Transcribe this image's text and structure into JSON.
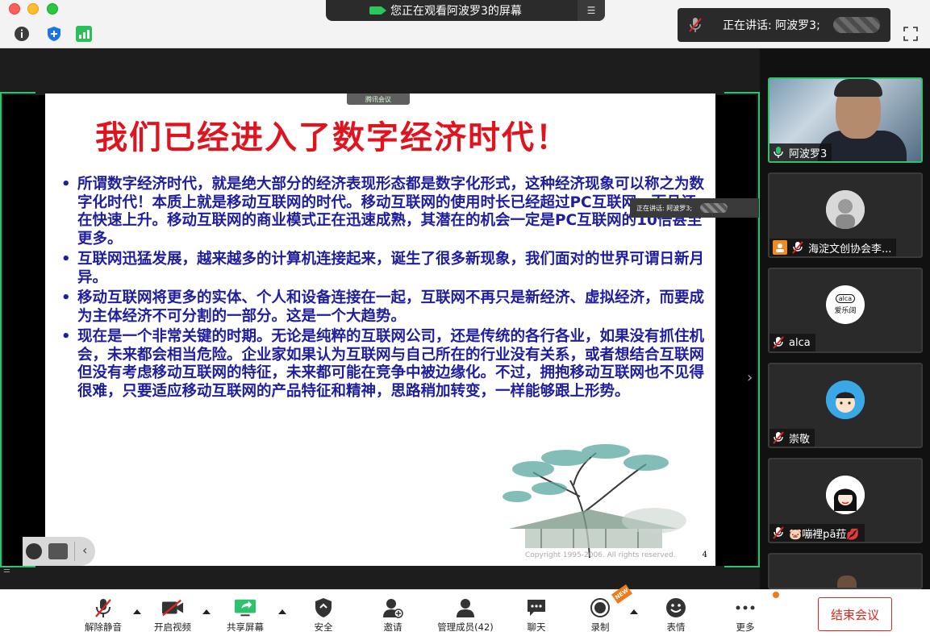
{
  "banner": {
    "text": "您正在观看阿波罗3的屏幕",
    "menu_icon": "menu-icon"
  },
  "speaking": {
    "label": "正在讲话: 阿波罗3;"
  },
  "slide": {
    "tag": "腾讯会议",
    "title": "我们已经进入了数字经济时代！",
    "bullets": [
      "所谓数字经济时代，就是绝大部分的经济表现形态都是数字化形式，这种经济现象可以称之为数字化时代！本质上就是移动互联网的时代。移动互联网的使用时长已经超过PC互联网，而且还在快速上升。移动互联网的商业模式正在迅速成熟，其潜在的机会一定是PC互联网的10倍甚至更多。",
      "互联网迅猛发展，越来越多的计算机连接起来，诞生了很多新现象，我们面对的世界可谓日新月异。",
      "移动互联网将更多的实体、个人和设备连接在一起，互联网不再只是新经济、虚拟经济，而要成为主体经济不可分割的一部分。这是一个大趋势。",
      "现在是一个非常关键的时期。无论是纯粹的互联网公司，还是传统的各行各业，如果没有抓住机会，未来都会相当危险。企业家如果认为互联网与自己所在的行业没有关系，或者想结合互联网但没有考虑移动互联网的特征，未来都可能在竞争中被边缘化。不过，拥抱移动互联网也不见得很难，只要适应移动互联网的产品特征和精神，思路稍加转变，一样能够跟上形势。"
    ],
    "bullet_char": "•",
    "page_number": "4",
    "watermark": "Copyright 1995-2006. All rights reserved.",
    "speaking_overlay": "正在讲话: 阿波罗3;"
  },
  "participants": [
    {
      "name": "阿波罗3",
      "mic": "on",
      "active": true
    },
    {
      "name": "海淀文创协会李...",
      "mic": "muted",
      "host": true
    },
    {
      "name": "alca",
      "mic": "muted",
      "avatar_text": "爱乐阔",
      "avatar_logo": "alca"
    },
    {
      "name": "崇敬",
      "mic": "muted"
    },
    {
      "name": "🐷嘣裡pā菈💋",
      "mic": "muted"
    }
  ],
  "toolbar": {
    "unmute": "解除静音",
    "start_video": "开启视频",
    "share_screen": "共享屏幕",
    "security": "安全",
    "invite": "邀请",
    "manage": "管理成员(42)",
    "chat": "聊天",
    "record": "录制",
    "record_badge": "NEW",
    "reactions": "表情",
    "more": "更多",
    "end": "结束会议"
  },
  "colors": {
    "title_red": "#e0141e",
    "bullet_blue": "#1e1e9e",
    "accent_green": "#2fc26d",
    "end_red": "#e0251f",
    "badge_orange": "#f07a1a"
  }
}
